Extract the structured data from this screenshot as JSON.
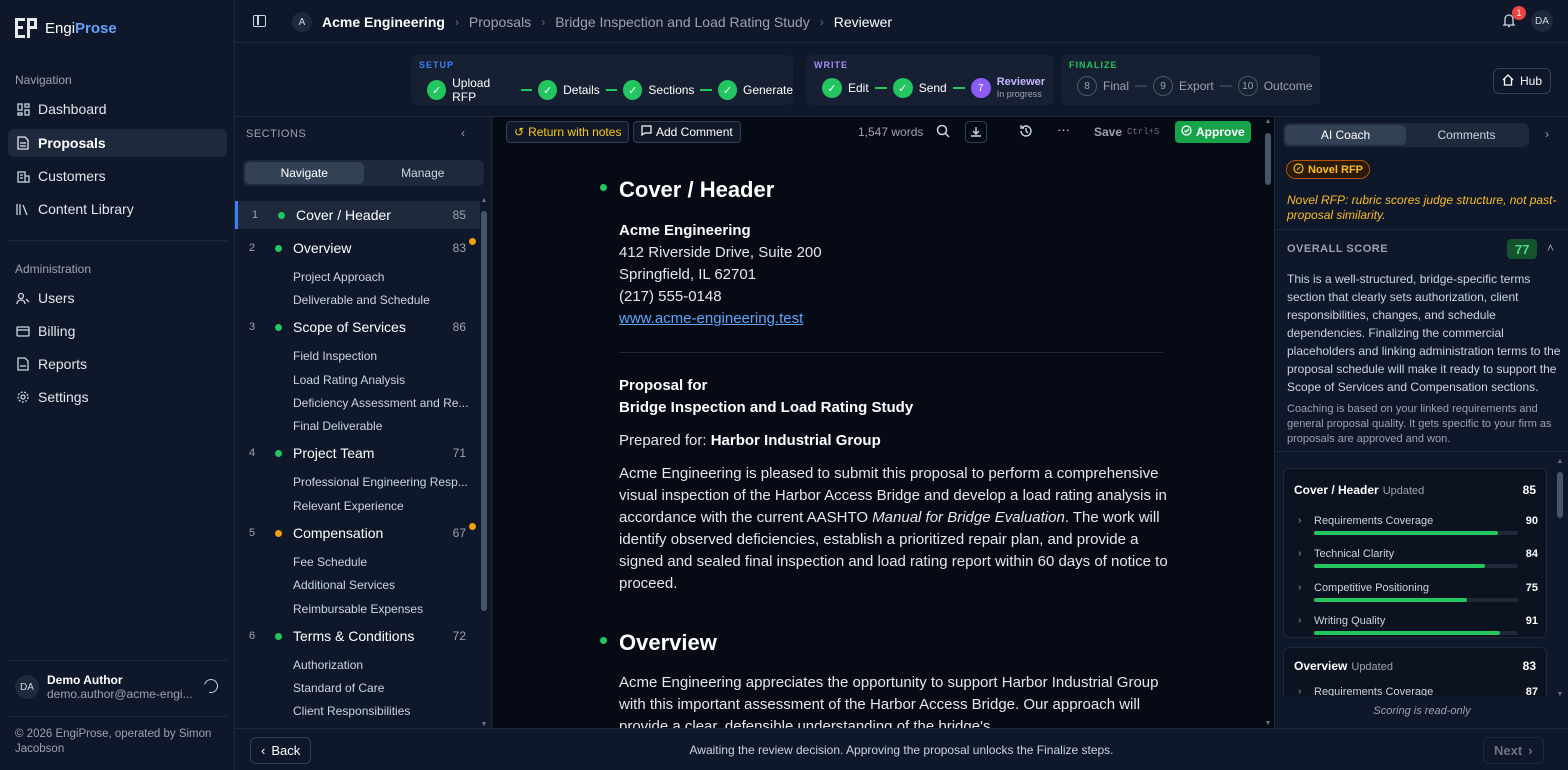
{
  "app": {
    "name_a": "Engi",
    "name_b": "Prose",
    "logo_icon": "ep-logo",
    "brand_color": "#60a5fa"
  },
  "sidebar": {
    "nav_heading": "Navigation",
    "nav": [
      {
        "label": "Dashboard",
        "icon": "grid-icon"
      },
      {
        "label": "Proposals",
        "icon": "document-icon"
      },
      {
        "label": "Customers",
        "icon": "building-icon"
      },
      {
        "label": "Content Library",
        "icon": "library-icon"
      }
    ],
    "admin_heading": "Administration",
    "admin": [
      {
        "label": "Users",
        "icon": "users-icon"
      },
      {
        "label": "Billing",
        "icon": "card-icon"
      },
      {
        "label": "Reports",
        "icon": "reports-icon"
      },
      {
        "label": "Settings",
        "icon": "gear-icon"
      }
    ],
    "user": {
      "initials": "DA",
      "name": "Demo Author",
      "email": "demo.author@acme-engi..."
    },
    "copyright": "© 2026 EngiProse, operated by Simon Jacobson"
  },
  "topbar": {
    "org_initial": "A",
    "org": "Acme Engineering",
    "crumbs": [
      "Proposals",
      "Bridge Inspection and Load Rating Study",
      "Reviewer"
    ],
    "notifications": "1",
    "avatar": "DA"
  },
  "stepper": {
    "setup_label": "SETUP",
    "write_label": "WRITE",
    "finalize_label": "FINALIZE",
    "setup": [
      "Upload RFP",
      "Details",
      "Sections",
      "Generate"
    ],
    "write": [
      "Edit",
      "Send"
    ],
    "current": {
      "num": "7",
      "label": "Reviewer",
      "status": "In progress"
    },
    "finalize": [
      {
        "num": "8",
        "label": "Final"
      },
      {
        "num": "9",
        "label": "Export"
      },
      {
        "num": "10",
        "label": "Outcome"
      }
    ],
    "hub": "Hub",
    "colors": {
      "setup": "#3b82f6",
      "write": "#a78bfa",
      "finalize": "#22c55e",
      "done": "#22c55e",
      "current": "#8b5cf6"
    }
  },
  "sections": {
    "title": "SECTIONS",
    "tab_navigate": "Navigate",
    "tab_manage": "Manage",
    "items": [
      {
        "num": "1",
        "title": "Cover / Header",
        "score": "85",
        "status": "green",
        "subs": []
      },
      {
        "num": "2",
        "title": "Overview",
        "score": "83",
        "status": "green",
        "subs": [
          "Project Approach",
          "Deliverable and Schedule"
        ]
      },
      {
        "num": "3",
        "title": "Scope of Services",
        "score": "86",
        "status": "green",
        "subs": [
          "Field Inspection",
          "Load Rating Analysis",
          "Deficiency Assessment and Re...",
          "Final Deliverable"
        ]
      },
      {
        "num": "4",
        "title": "Project Team",
        "score": "71",
        "status": "green",
        "subs": [
          "Professional Engineering Resp...",
          "Relevant Experience"
        ]
      },
      {
        "num": "5",
        "title": "Compensation",
        "score": "67",
        "status": "yellow",
        "subs": [
          "Fee Schedule",
          "Additional Services",
          "Reimbursable Expenses"
        ]
      },
      {
        "num": "6",
        "title": "Terms & Conditions",
        "score": "72",
        "status": "green",
        "subs": [
          "Authorization",
          "Standard of Care",
          "Client Responsibilities"
        ]
      }
    ]
  },
  "editor": {
    "return_label": "Return with notes",
    "add_comment": "Add Comment",
    "words": "1,547 words",
    "save": "Save",
    "save_kbd": "Ctrl+S",
    "approve": "Approve",
    "cover_heading": "Cover / Header",
    "company": "Acme Engineering",
    "address1": "412 Riverside Drive, Suite 200",
    "address2": "Springfield, IL 62701",
    "phone": "(217) 555-0148",
    "website": "www.acme-engineering.test",
    "proposal_for": "Proposal for",
    "project": "Bridge Inspection and Load Rating Study",
    "prepared_for_label": "Prepared for:",
    "client": "Harbor Industrial Group",
    "intro_a": "Acme Engineering is pleased to submit this proposal to perform a comprehensive visual inspection of the Harbor Access Bridge and develop a load rating analysis in accordance with the current AASHTO ",
    "intro_em": "Manual for Bridge Evaluation",
    "intro_b": ". The work will identify observed deficiencies, establish a prioritized repair plan, and provide a signed and sealed final inspection and load rating report within 60 days of notice to proceed.",
    "overview_heading": "Overview",
    "overview_text": "Acme Engineering appreciates the opportunity to support Harbor Industrial Group with this important assessment of the Harbor Access Bridge. Our approach will provide a clear, defensible understanding of the bridge's"
  },
  "coach": {
    "tab_ai": "AI Coach",
    "tab_comments": "Comments",
    "novel": "Novel RFP",
    "novel_note": "Novel RFP: rubric scores judge structure, not past-proposal similarity.",
    "overall_label": "OVERALL SCORE",
    "overall_score": "77",
    "summary": "This is a well-structured, bridge-specific terms section that clearly sets authorization, client responsibilities, changes, and schedule dependencies. Finalizing the commercial placeholders and linking administration terms to the proposal schedule will make it ready to support the Scope of Services and Compensation sections.",
    "note": "Coaching is based on your linked requirements and general proposal quality. It gets specific to your firm as proposals are approved and won.",
    "cards": [
      {
        "title": "Cover / Header",
        "updated": "Updated",
        "score": "85",
        "criteria": [
          {
            "label": "Requirements Coverage",
            "value": 90
          },
          {
            "label": "Technical Clarity",
            "value": 84
          },
          {
            "label": "Competitive Positioning",
            "value": 75
          },
          {
            "label": "Writing Quality",
            "value": 91
          }
        ]
      },
      {
        "title": "Overview",
        "updated": "Updated",
        "score": "83",
        "criteria": [
          {
            "label": "Requirements Coverage",
            "value": 87
          }
        ]
      }
    ],
    "readonly": "Scoring is read-only"
  },
  "footer": {
    "back": "Back",
    "message": "Awaiting the review decision. Approving the proposal unlocks the Finalize steps.",
    "next": "Next"
  }
}
